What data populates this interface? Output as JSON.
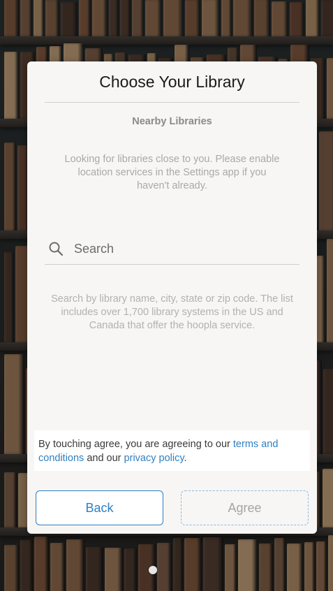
{
  "modal": {
    "title": "Choose Your Library",
    "nearby_heading": "Nearby Libraries",
    "location_message": "Looking for libraries close to you. Please enable location services in the Settings app if you haven't already.",
    "search": {
      "placeholder": "Search",
      "value": "",
      "icon": "search-icon"
    },
    "search_help": "Search by library name, city, state or zip code. The list includes over 1,700 library systems in the US and Canada that offer the hoopla service.",
    "terms": {
      "prefix": "By touching agree, you are agreeing to our ",
      "terms_link": "terms and conditions",
      "middle": " and our ",
      "privacy_link": "privacy policy",
      "suffix": "."
    },
    "buttons": {
      "back": "Back",
      "agree": "Agree"
    }
  },
  "colors": {
    "accent": "#2f7fc1",
    "card_background": "#f7f6f5",
    "muted_text": "#a9a9a9"
  }
}
